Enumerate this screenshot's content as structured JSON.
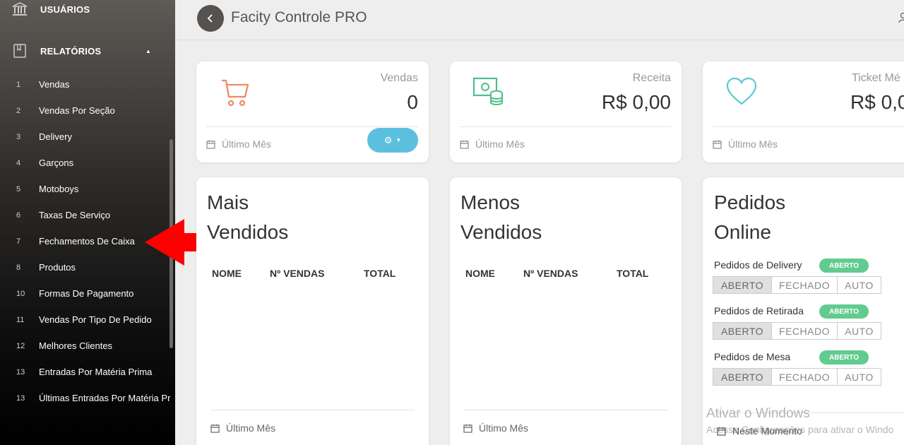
{
  "sidebar": {
    "usuarios_label": "USUÁRIOS",
    "relatorios_label": "RELATÓRIOS",
    "items": [
      {
        "num": "1",
        "label": "Vendas"
      },
      {
        "num": "2",
        "label": "Vendas Por Seção"
      },
      {
        "num": "3",
        "label": "Delivery"
      },
      {
        "num": "4",
        "label": "Garçons"
      },
      {
        "num": "5",
        "label": "Motoboys"
      },
      {
        "num": "6",
        "label": "Taxas De Serviço"
      },
      {
        "num": "7",
        "label": "Fechamentos De Caixa"
      },
      {
        "num": "8",
        "label": "Produtos"
      },
      {
        "num": "10",
        "label": "Formas De Pagamento"
      },
      {
        "num": "11",
        "label": "Vendas Por Tipo De Pedido"
      },
      {
        "num": "12",
        "label": "Melhores Clientes"
      },
      {
        "num": "13",
        "label": "Entradas Por Matéria Prima"
      },
      {
        "num": "13",
        "label": "Últimas Entradas Por Matéria Pr"
      }
    ]
  },
  "header": {
    "title": "Facity Controle PRO"
  },
  "stats": {
    "vendas": {
      "label": "Vendas",
      "value": "0",
      "footer": "Último Mês"
    },
    "receita": {
      "label": "Receita",
      "value": "R$ 0,00",
      "footer": "Último Mês"
    },
    "ticket": {
      "label": "Ticket Mé",
      "value": "R$ 0,0",
      "footer": "Último Mês"
    }
  },
  "mais_vendidos": {
    "title_line1": "Mais",
    "title_line2": "Vendidos",
    "columns": [
      "NOME",
      "Nº VENDAS",
      "TOTAL"
    ],
    "footer": "Último Mês"
  },
  "menos_vendidos": {
    "title_line1": "Menos",
    "title_line2": "Vendidos",
    "columns": [
      "NOME",
      "Nº VENDAS",
      "TOTAL"
    ],
    "footer": "Último Mês"
  },
  "pedidos_online": {
    "title_line1": "Pedidos",
    "title_line2": "Online",
    "rows": [
      {
        "label": "Pedidos de Delivery",
        "status": "ABERTO"
      },
      {
        "label": "Pedidos de Retirada",
        "status": "ABERTO"
      },
      {
        "label": "Pedidos de Mesa",
        "status": "ABERTO"
      }
    ],
    "options": [
      "ABERTO",
      "FECHADO",
      "AUTO"
    ],
    "footer": "Neste Momento"
  },
  "watermark": {
    "line1": "Ativar o Windows",
    "line2": "Acesse Configurações para ativar o Windo"
  },
  "colors": {
    "cart": "#ef8a62",
    "money": "#4cbf8a",
    "heart": "#5bc8d0",
    "settings_button": "#5bc0de",
    "badge": "#62cb8f",
    "arrow": "#ff0000"
  },
  "icons": {
    "usuarios": "bank-icon",
    "relatorios": "book-icon",
    "back": "chevron-left-icon",
    "user": "user-icon",
    "calendar": "calendar-icon",
    "settings": "gear-icon"
  }
}
